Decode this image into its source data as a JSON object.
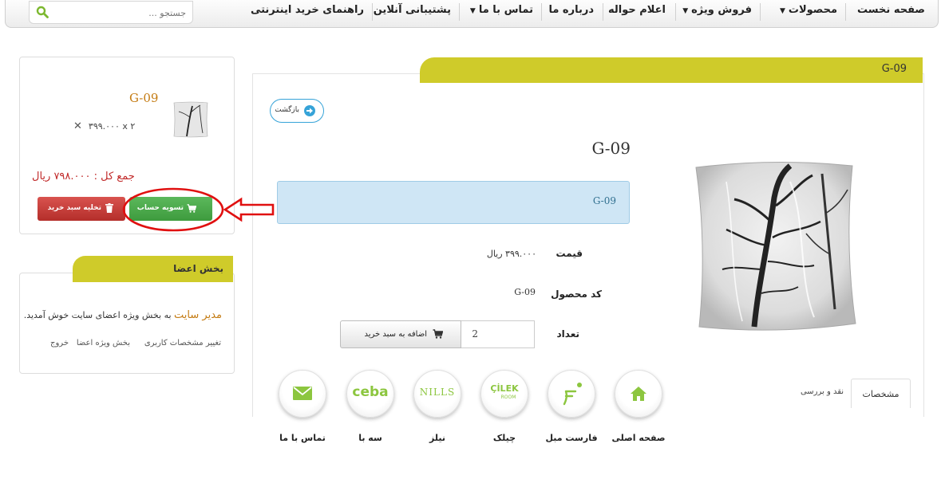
{
  "nav": {
    "items": [
      {
        "label": "صفحه نخست",
        "dropdown": false
      },
      {
        "label": "محصولات",
        "dropdown": true
      },
      {
        "label": "فروش ویژه",
        "dropdown": true
      },
      {
        "label": "اعلام حواله",
        "dropdown": false
      },
      {
        "label": "درباره ما",
        "dropdown": false
      },
      {
        "label": "تماس با ما",
        "dropdown": true
      },
      {
        "label": "پشتیبانی آنلاین",
        "dropdown": false
      },
      {
        "label": "راهنمای خرید اینترنتی",
        "dropdown": false
      }
    ],
    "search_placeholder": "جستجو ..."
  },
  "product": {
    "tab_title": "G-09",
    "back_label": "بازگشت",
    "title": "G-09",
    "description": "G-09",
    "price_label": "قیمت",
    "price_value": "۳۹۹.۰۰۰ ریال",
    "code_label": "کد محصول",
    "code_value": "G-09",
    "qty_label": "تعداد",
    "qty_value": "2",
    "add_to_cart_label": "اضافه به سبد خرید"
  },
  "tabs": {
    "specs": "مشخصات",
    "review": "نقد و بررسی"
  },
  "shortcuts": [
    {
      "label": "صفحه اصلی",
      "icon": "home-icon"
    },
    {
      "label": "فارست مبل",
      "icon": "forest-mobl-logo-icon"
    },
    {
      "label": "چیلک",
      "icon": "cilek-logo-icon",
      "logo_text": "ÇİLEK",
      "logo_sub": "ROOM"
    },
    {
      "label": "نیلز",
      "icon": "nills-logo-icon",
      "logo_text": "NILLS"
    },
    {
      "label": "سه با",
      "icon": "ceba-logo-icon",
      "logo_text": "ceba"
    },
    {
      "label": "تماس با ما",
      "icon": "envelope-icon"
    }
  ],
  "cart": {
    "item_name": "G-09",
    "quantity_line": "۳۹۹.۰۰۰ x ۲",
    "remove_symbol": "✕",
    "total": "جمع کل : ۷۹۸.۰۰۰ ریال",
    "checkout_label": "تسویه حساب",
    "clear_label": "تخلیه سبد خرید"
  },
  "members": {
    "title": "بخش اعضا",
    "welcome_name": "مدیر سایت",
    "welcome_text": " به بخش ویژه اعضای سایت خوش آمدید.",
    "links": [
      "تغییر مشخصات کاربری",
      "بخش ویژه اعضا",
      "خروج"
    ]
  },
  "colors": {
    "accent_olive": "#cfcb2a",
    "shortcut_green": "#8cc63f",
    "checkout_green": "#4cae4c",
    "clear_red": "#c9302c",
    "annotation_red": "#e01010",
    "link_blue": "#36a3d8"
  }
}
